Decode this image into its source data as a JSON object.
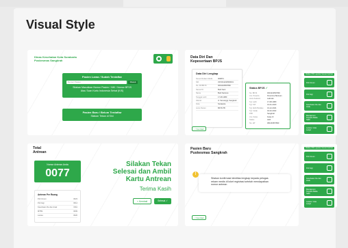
{
  "page": {
    "title": "Visual Style"
  },
  "panel1": {
    "header_line1": "Dinas Kesehatan Kota Surakarta",
    "header_line2": "Puskesmas Sangkrah",
    "card_a": {
      "title": "Pasien Lama / Sudah Terdaftar",
      "input_placeholder": "Nomor Pasien",
      "search_label": "Masuk",
      "desc_line1": "Silakan Masukkan Nomor Pasien / NIK / Nomor BPJS",
      "desc_line2": "Atau Scan Kartu Indonesia Sehat (KIS)"
    },
    "card_b": {
      "title": "Pasien Baru / Belum Terdaftar",
      "subtitle": "Silakan Tekan di Sini"
    }
  },
  "panel2": {
    "title_line1": "Data Diri Dan",
    "title_line2": "Kepesertaan BPJS",
    "form_title": "Data Diri Lengkap",
    "form_rows": [
      {
        "label": "Nomor Rekam Medis",
        "value": "000874"
      },
      {
        "label": "NIK",
        "value": "3372011234560001"
      },
      {
        "label": "No. KK/BPJS",
        "value": "0001234567890"
      },
      {
        "label": "Nama KK",
        "value": "Budi Sant"
      },
      {
        "label": "Nama",
        "value": "Budi Santoso"
      },
      {
        "label": "Tanggal Lahir",
        "value": "17-08-1980"
      },
      {
        "label": "Alamat",
        "value": "Jl. Semanggi, Sangkrah"
      },
      {
        "label": "Kota",
        "value": "Surakarta"
      },
      {
        "label": "Jenis Pasien",
        "value": "BPJS PB"
      }
    ],
    "status_title": "Status BPJS",
    "status_rows": [
      {
        "label": "No. BPJS",
        "value": "0001234567890"
      },
      {
        "label": "Jns. Peserta",
        "value": "Penerima Bantuan"
      },
      {
        "label": "Jenis Kelamin",
        "value": "Laki-laki"
      },
      {
        "label": "Tgl. Lahir",
        "value": "17-08-1980"
      },
      {
        "label": "Tgl. TAT",
        "value": "01-01-2020"
      },
      {
        "label": "Tgl. Akhir Berlaku",
        "value": "31-12-2024"
      },
      {
        "label": "Tgl. Cetak",
        "value": "02-02-2022"
      },
      {
        "label": "PPK",
        "value": "Sangkrah"
      },
      {
        "label": "Jns. Kelas",
        "value": "Kelas III"
      },
      {
        "label": "Status",
        "value": "Aktif"
      },
      {
        "label": "No. HP",
        "value": "081234567890"
      }
    ],
    "back_label": "< Kembali"
  },
  "side_menu": {
    "header": "Silakan Pilih Layanan Sesuai Keluhan",
    "items": [
      {
        "label": "Poli Umum",
        "icon": "stethoscope-icon"
      },
      {
        "label": "Poli Gigi",
        "icon": "tooth-icon"
      },
      {
        "label": "Kesehatan Ibu dan Anak",
        "icon": "mother-child-icon"
      },
      {
        "label": "Manajemen Terpadu Balita Sakit",
        "icon": "baby-icon"
      },
      {
        "label": "Lansia / Usia Lanjut",
        "icon": "elderly-icon"
      }
    ]
  },
  "panel3": {
    "label_line1": "Total",
    "label_line2": "Antrean",
    "number_title": "Nomor Antrean Anda",
    "number": "0077",
    "queue_title": "Antrean Per Ruang",
    "queue_rows": [
      {
        "room": "Poli Umum",
        "value": "0023"
      },
      {
        "room": "Poli Gigi",
        "value": "0014"
      },
      {
        "room": "Kesehatan Ibu dan Anak",
        "value": "0011"
      },
      {
        "room": "MTBS",
        "value": "0009"
      },
      {
        "room": "Lansia",
        "value": "0020"
      }
    ],
    "main_line1": "Silakan Tekan",
    "main_line2": "Selesai dan Ambil",
    "main_line3": "Kartu Antrean",
    "thanks": "Terima Kasih",
    "back_label": "< Kembali",
    "done_label": "Selesai ✓"
  },
  "panel4": {
    "title_line1": "Pasien Baru",
    "title_line2": "Puskesmas Sangkrah",
    "dialog_line1": "Silakan konfirmasi identitas lengkap kepada petugas",
    "dialog_line2": "rekam medis di loket registrasi setelah mendapatkan",
    "dialog_line3": "nomor antrean",
    "back_label": "< Kembali"
  },
  "colors": {
    "accent": "#2ea84a",
    "warning": "#f1c232"
  }
}
